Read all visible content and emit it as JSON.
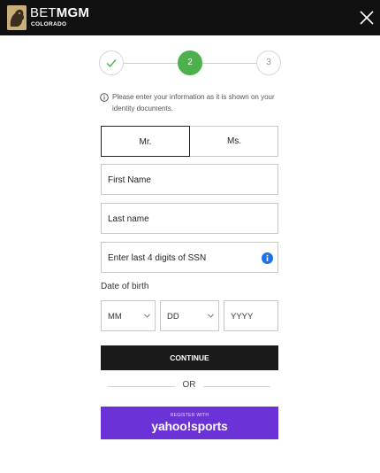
{
  "header": {
    "brand_light": "BET",
    "brand_bold": "MGM",
    "region": "COLORADO",
    "logo_icon": "lion-logo-icon",
    "close_icon": "close-icon"
  },
  "stepper": {
    "steps": [
      {
        "label": "",
        "state": "complete",
        "icon": "check-icon"
      },
      {
        "label": "2",
        "state": "active"
      },
      {
        "label": "3",
        "state": "upcoming"
      }
    ],
    "active_color": "#4cb14b"
  },
  "info": {
    "icon": "info-circle-icon",
    "text": "Please enter your information as it is shown on your identity documents."
  },
  "salutation": {
    "options": [
      "Mr.",
      "Ms."
    ],
    "selected": "Mr."
  },
  "form": {
    "first_name_placeholder": "First Name",
    "last_name_placeholder": "Last name",
    "ssn_placeholder": "Enter last 4 digits of SSN",
    "ssn_info_icon": "info-icon",
    "ssn_info_color": "#1a73e8",
    "dob_label": "Date of birth",
    "dob_month_placeholder": "MM",
    "dob_day_placeholder": "DD",
    "dob_year_placeholder": "YYYY"
  },
  "actions": {
    "continue_label": "CONTINUE",
    "or_label": "OR",
    "yahoo_small": "REGISTER WITH",
    "yahoo_big": "yahoo!sports",
    "yahoo_color": "#6b32d8"
  }
}
